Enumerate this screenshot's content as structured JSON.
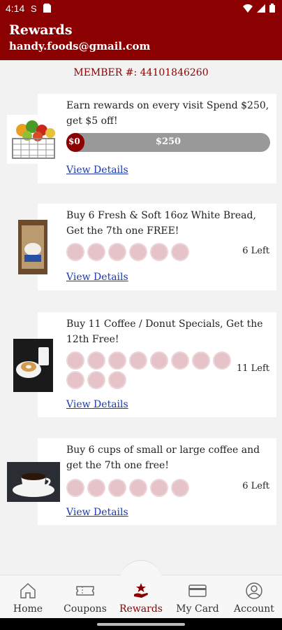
{
  "status": {
    "time": "4:14"
  },
  "header": {
    "title": "Rewards",
    "email": "handy.foods@gmail.com"
  },
  "member": {
    "label": "MEMBER #: 44101846260"
  },
  "cards": [
    {
      "text": "Earn rewards on every visit Spend $250, get $5 off!",
      "progress_min": "$0",
      "progress_max": "$250",
      "progress": 0,
      "link": "View Details"
    },
    {
      "text": "Buy 6 Fresh & Soft 16oz White Bread, Get the 7th one FREE!",
      "left": "6 Left",
      "stamps_total": 6,
      "stamps_filled": 0,
      "link": "View Details"
    },
    {
      "text": "Buy 11 Coffee / Donut Specials, Get the 12th Free!",
      "left": "11 Left",
      "stamps_total": 11,
      "stamps_filled": 0,
      "link": "View Details"
    },
    {
      "text": "Buy 6 cups of small or large coffee and get the 7th one free!",
      "left": "6 Left",
      "stamps_total": 6,
      "stamps_filled": 0,
      "link": "View Details"
    }
  ],
  "nav": {
    "home": "Home",
    "coupons": "Coupons",
    "rewards": "Rewards",
    "mycard": "My Card",
    "account": "Account",
    "active": "Rewards"
  },
  "colors": {
    "brand": "#8b0000",
    "stamp": "#e5c3c8",
    "link": "#1a39b0"
  },
  "icons": [
    "home-icon",
    "coupon-icon",
    "rewards-icon",
    "card-icon",
    "account-icon"
  ]
}
